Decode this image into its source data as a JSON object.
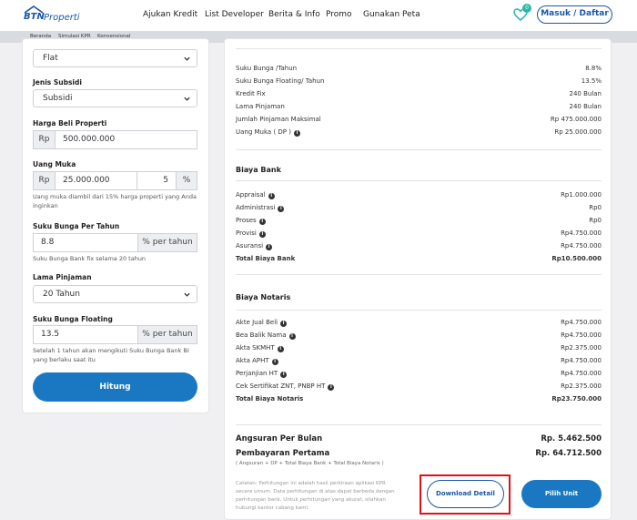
{
  "header": {
    "logo_text": "BTN",
    "logo_sub": "Properti",
    "nav": [
      "Ajukan Kredit",
      "List Developer",
      "Berita & Info",
      "Promo",
      "Gunakan Peta"
    ],
    "notif_count": "0",
    "login_label": "Masuk / Daftar"
  },
  "breadcrumb": [
    "Beranda",
    "Simulasi KPR",
    "Konvensional"
  ],
  "form": {
    "rate_type_value": "Flat",
    "subsidy_label": "Jenis Subsidi",
    "subsidy_value": "Subsidi",
    "price_label": "Harga Beli Properti",
    "price_prefix": "Rp",
    "price_value": "500.000.000",
    "dp_label": "Uang Muka",
    "dp_prefix": "Rp",
    "dp_value": "25.000.000",
    "dp_percent": "5",
    "dp_percent_sign": "%",
    "dp_help": "Uang muka diambil dari 15% harga properti yang Anda inginkan",
    "rate_label": "Suku Bunga Per Tahun",
    "rate_value": "8.8",
    "rate_suffix": "% per tahun",
    "rate_help": "Suku Bunga Bank fix selama 20 tahun",
    "term_label": "Lama Pinjaman",
    "term_value": "20 Tahun",
    "floating_label": "Suku Bunga Floating",
    "floating_value": "13.5",
    "floating_suffix": "% per tahun",
    "floating_help": "Setelah 1 tahun akan mengikuti Suku Bunga Bank BI yang berlaku saat itu",
    "submit_label": "Hitung"
  },
  "info": {
    "rows": [
      {
        "label": "Suku Bunga /Tahun",
        "value": "8.8%"
      },
      {
        "label": "Suku Bunga Floating/ Tahun",
        "value": "13.5%"
      },
      {
        "label": "Kredit Fix",
        "value": "240 Bulan"
      },
      {
        "label": "Lama Pinjaman",
        "value": "240 Bulan"
      },
      {
        "label": "Jumlah Pinjaman Maksimal",
        "value": "Rp 475.000.000"
      },
      {
        "label": "Uang Muka ( DP )",
        "value": "Rp 25.000.000"
      }
    ]
  },
  "bank": {
    "title": "Biaya Bank",
    "rows": [
      {
        "label": "Appraisal",
        "value": "Rp1.000.000"
      },
      {
        "label": "Administrasi",
        "value": "Rp0"
      },
      {
        "label": "Proses",
        "value": "Rp0"
      },
      {
        "label": "Provisi",
        "value": "Rp4.750.000"
      },
      {
        "label": "Asuransi",
        "value": "Rp4.750.000"
      }
    ],
    "total_label": "Total Biaya Bank",
    "total_value": "Rp10.500.000"
  },
  "notaris": {
    "title": "Biaya Notaris",
    "rows": [
      {
        "label": "Akte Jual Beli",
        "value": "Rp4.750.000"
      },
      {
        "label": "Bea Balik Nama",
        "value": "Rp4.750.000"
      },
      {
        "label": "Akta SKMHT",
        "value": "Rp2.375.000"
      },
      {
        "label": "Akta APHT",
        "value": "Rp4.750.000"
      },
      {
        "label": "Perjanjian HT",
        "value": "Rp4.750.000"
      },
      {
        "label": "Cek Sertifikat ZNT, PNBP HT",
        "value": "Rp2.375.000"
      }
    ],
    "total_label": "Total Biaya Notaris",
    "total_value": "Rp23.750.000"
  },
  "summary": {
    "monthly_label": "Angsuran Per Bulan",
    "monthly_value": "Rp. 5.462.500",
    "first_label": "Pembayaran Pertama",
    "first_value": "Rp. 64.712.500",
    "first_note": "( Angsuran + DP + Total Biaya Bank + Total Biaya Notaris )",
    "disclaimer": "Catatan: Perhitungan ini adalah hasil perkiraan aplikasi KPR secara umum. Data perhitungan di atas dapat berbeda dengan perhitungan bank. Untuk perhitungan yang akurat, silahkan hubungi kantor cabang kami.",
    "download_label": "Download Detail",
    "choose_label": "Pilih Unit"
  },
  "colors": {
    "brand": "#1a56a7",
    "button": "#1a78c2",
    "highlight": "#e0101a",
    "badge": "#2bb7a8"
  }
}
